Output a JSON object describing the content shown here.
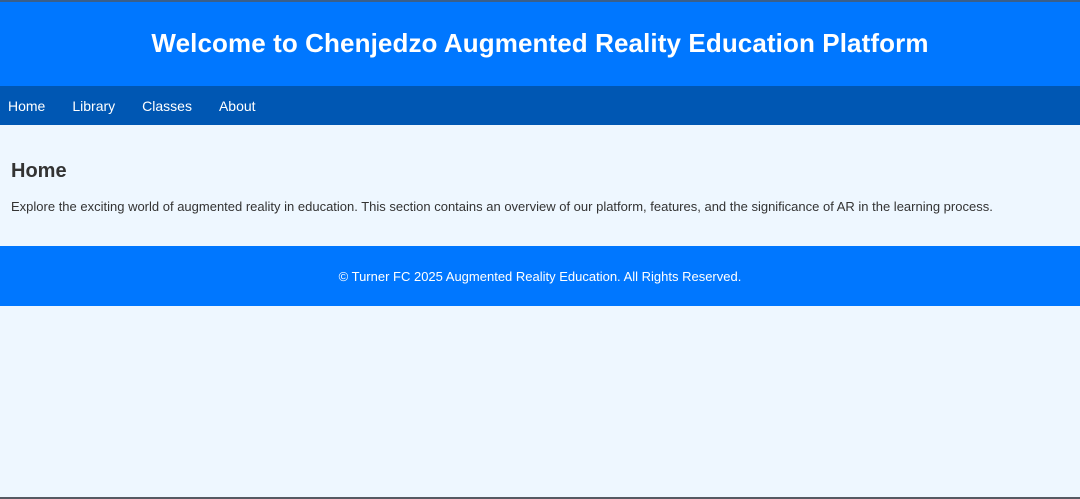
{
  "header": {
    "title": "Welcome to Chenjedzo Augmented Reality Education Platform"
  },
  "nav": {
    "items": [
      {
        "label": "Home"
      },
      {
        "label": "Library"
      },
      {
        "label": "Classes"
      },
      {
        "label": "About"
      }
    ]
  },
  "main": {
    "heading": "Home",
    "text": "Explore the exciting world of augmented reality in education. This section contains an overview of our platform, features, and the significance of AR in the learning process."
  },
  "footer": {
    "text": "© Turner FC 2025 Augmented Reality Education. All Rights Reserved."
  },
  "colors": {
    "header_bg": "#0077ff",
    "nav_bg": "#0057b3",
    "page_bg": "#eef7ff",
    "text": "#333333"
  }
}
